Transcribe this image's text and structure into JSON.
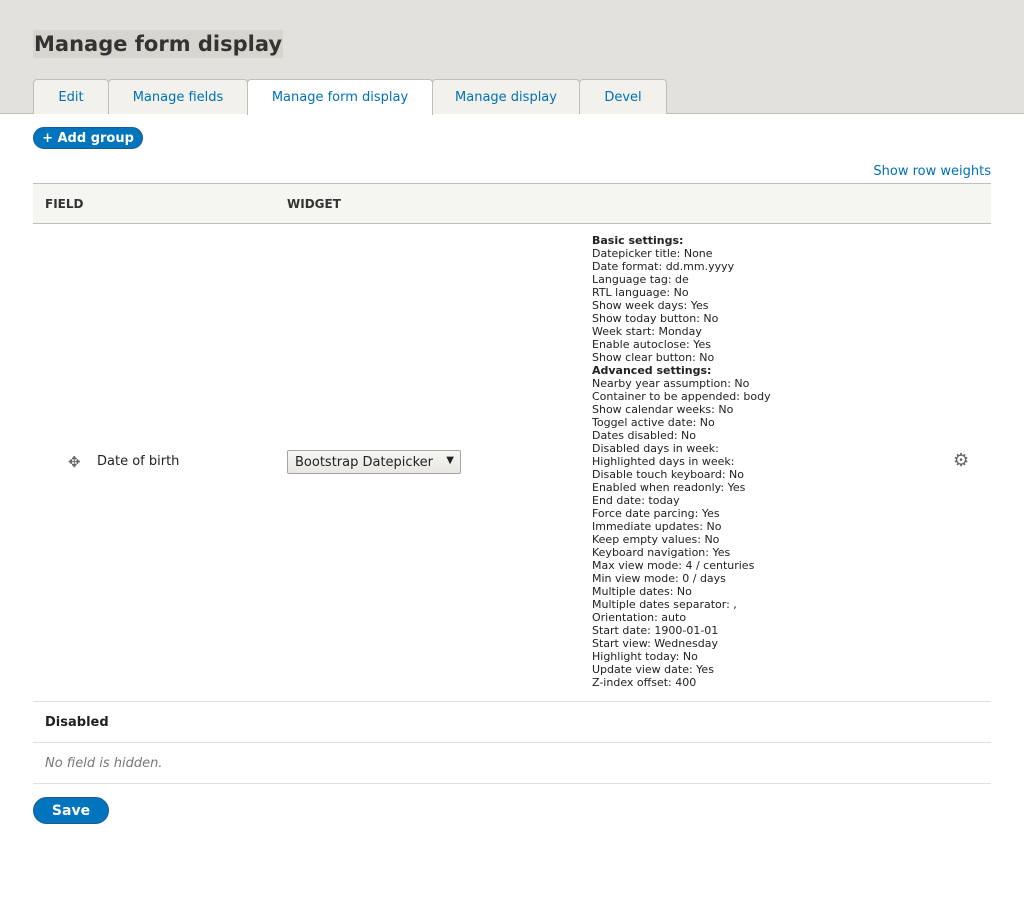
{
  "header": {
    "title": "Manage form display"
  },
  "tabs": [
    {
      "label": "Edit"
    },
    {
      "label": "Manage fields"
    },
    {
      "label": "Manage form display"
    },
    {
      "label": "Manage display"
    },
    {
      "label": "Devel"
    }
  ],
  "add_group": "+ Add group",
  "show_row_weights": "Show row weights",
  "table": {
    "col_field": "FIELD",
    "col_widget": "WIDGET"
  },
  "row": {
    "field": "Date of birth",
    "widget": "Bootstrap Datepicker",
    "basic_heading": "Basic settings:",
    "basic": [
      "Datepicker title: None",
      "Date format: dd.mm.yyyy",
      "Language tag: de",
      "RTL language: No",
      "Show week days: Yes",
      "Show today button: No",
      "Week start: Monday",
      "Enable autoclose: Yes",
      "Show clear button: No"
    ],
    "advanced_heading": "Advanced settings:",
    "advanced": [
      "Nearby year assumption: No",
      "Container to be appended: body",
      "Show calendar weeks: No",
      "Toggel active date: No",
      "Dates disabled: No",
      "Disabled days in week:",
      "Highlighted days in week:",
      "Disable touch keyboard: No",
      "Enabled when readonly: Yes",
      "End date: today",
      "Force date parcing: Yes",
      "Immediate updates: No",
      "Keep empty values: No",
      "Keyboard navigation: Yes",
      "Max view mode: 4 / centuries",
      "Min view mode: 0 / days",
      "Multiple dates: No",
      "Multiple dates separator: ,",
      "Orientation: auto",
      "Start date: 1900-01-01",
      "Start view: Wednesday",
      "Highlight today: No",
      "Update view date: Yes",
      "Z-index offset: 400"
    ]
  },
  "disabled_label": "Disabled",
  "no_hidden": "No field is hidden.",
  "save": "Save"
}
